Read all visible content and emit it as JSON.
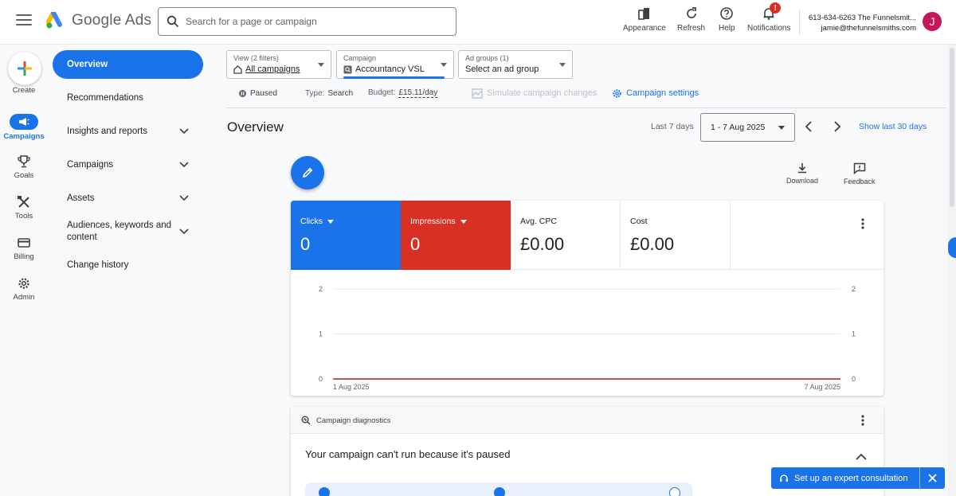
{
  "header": {
    "app_name": "Google Ads",
    "search_placeholder": "Search for a page or campaign",
    "buttons": {
      "appearance": "Appearance",
      "refresh": "Refresh",
      "help": "Help",
      "notifications": "Notifications"
    },
    "notification_badge": "!",
    "account_line1": "613-634-6263 The Funnelsmit...",
    "account_line2": "jamie@thefunnelsmiths.com",
    "avatar_initial": "J"
  },
  "rail": {
    "create": "Create",
    "campaigns": "Campaigns",
    "goals": "Goals",
    "tools": "Tools",
    "billing": "Billing",
    "admin": "Admin"
  },
  "nav": {
    "overview": "Overview",
    "recommendations": "Recommendations",
    "insights": "Insights and reports",
    "campaigns": "Campaigns",
    "assets": "Assets",
    "audiences_line1": "Audiences, keywords and",
    "audiences_line2": "content",
    "change_history": "Change history"
  },
  "filters": {
    "view_label": "View (2 filters)",
    "view_value": "All campaigns",
    "campaign_label": "Campaign",
    "campaign_value": "Accountancy VSL",
    "adgroups_label": "Ad groups (1)",
    "adgroups_value": "Select an ad group"
  },
  "status": {
    "paused": "Paused",
    "type_label": "Type:",
    "type_value": "Search",
    "budget_label": "Budget:",
    "budget_value": "£15.11/day",
    "simulate": "Simulate campaign changes",
    "settings": "Campaign settings"
  },
  "overview": {
    "title": "Overview",
    "range_label": "Last 7 days",
    "range_value": "1 - 7 Aug 2025",
    "show_last": "Show last 30 days",
    "download": "Download",
    "feedback": "Feedback"
  },
  "metrics": {
    "clicks_label": "Clicks",
    "clicks_value": "0",
    "impressions_label": "Impressions",
    "impressions_value": "0",
    "cpc_label": "Avg. CPC",
    "cpc_value": "£0.00",
    "cost_label": "Cost",
    "cost_value": "£0.00"
  },
  "chart_data": {
    "type": "line",
    "x": [
      "1 Aug 2025",
      "7 Aug 2025"
    ],
    "series": [
      {
        "name": "Clicks",
        "values": [
          0,
          0
        ]
      },
      {
        "name": "Impressions",
        "values": [
          0,
          0
        ]
      }
    ],
    "y_ticks": [
      "0",
      "1",
      "2"
    ],
    "ylim": [
      0,
      2
    ],
    "colors": {
      "clicks": "#1a73e8",
      "impressions": "#d93025"
    }
  },
  "diagnostics": {
    "title": "Campaign diagnostics",
    "message": "Your campaign can't run because it's paused"
  },
  "consult": {
    "label": "Set up an expert consultation"
  },
  "colors": {
    "primary": "#1a73e8",
    "impressions": "#d93025"
  }
}
